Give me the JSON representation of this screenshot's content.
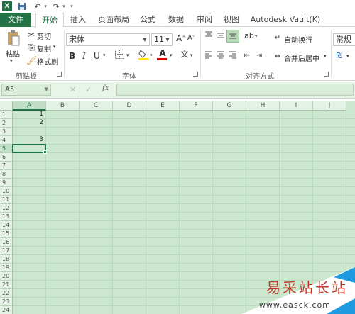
{
  "quick_access": {
    "icons": [
      "excel-logo-icon",
      "save-icon",
      "undo-icon",
      "redo-icon",
      "customize-icon"
    ]
  },
  "tabs": [
    {
      "label": "文件"
    },
    {
      "label": "开始"
    },
    {
      "label": "插入"
    },
    {
      "label": "页面布局"
    },
    {
      "label": "公式"
    },
    {
      "label": "数据"
    },
    {
      "label": "审阅"
    },
    {
      "label": "视图"
    },
    {
      "label": "Autodesk Vault(K)"
    }
  ],
  "ribbon": {
    "clipboard": {
      "paste": "粘贴",
      "cut": "剪切",
      "copy": "复制",
      "format_painter": "格式刷",
      "label": "剪贴板"
    },
    "font": {
      "font_name": "宋体",
      "font_size": "11",
      "bold": "B",
      "italic": "I",
      "underline": "U",
      "grow": "A",
      "shrink": "A",
      "font_color_letter": "A",
      "phonetic": "文",
      "label": "字体"
    },
    "alignment": {
      "wrap_text": "自动换行",
      "merge_center": "合并后居中",
      "label": "对齐方式"
    },
    "number": {
      "format": "常规"
    }
  },
  "formula_bar": {
    "name_box": "A5",
    "fx": "fx",
    "value": ""
  },
  "grid": {
    "columns": [
      "A",
      "B",
      "C",
      "D",
      "E",
      "F",
      "G",
      "H",
      "I",
      "J"
    ],
    "rows": [
      "1",
      "2",
      "3",
      "4",
      "5",
      "6",
      "7",
      "8",
      "9",
      "10",
      "11",
      "12",
      "13",
      "14",
      "15",
      "16",
      "17",
      "18",
      "19",
      "20",
      "21",
      "22",
      "23",
      "24"
    ],
    "cells": [
      {
        "ref": "A1",
        "value": "1"
      },
      {
        "ref": "A2",
        "value": "2"
      },
      {
        "ref": "A4",
        "value": "3"
      }
    ],
    "selected": "A5"
  },
  "watermark": {
    "text": "易采站长站",
    "url": "www.easck.com"
  },
  "colors": {
    "accent": "#217346",
    "sheet_bg": "#cce8cf"
  }
}
